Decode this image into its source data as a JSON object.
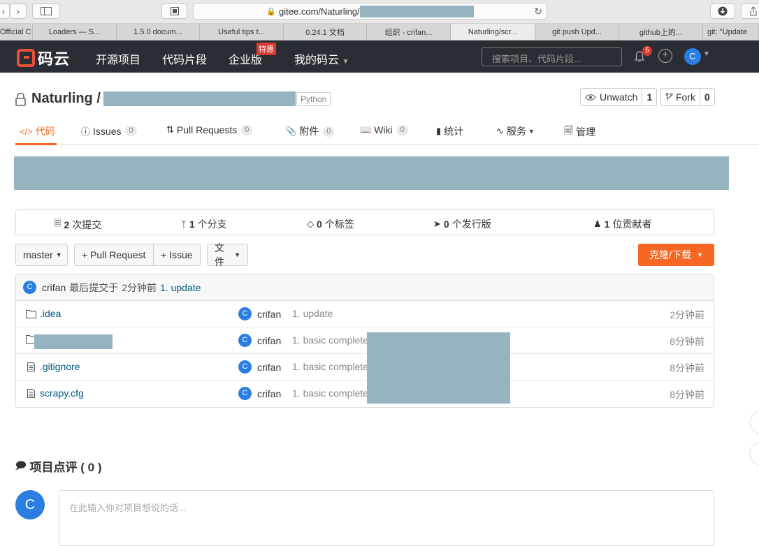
{
  "browser": {
    "url_prefix": "gitee.com/Naturling/",
    "tabs": [
      {
        "label": "Official C"
      },
      {
        "label": "Loaders — S..."
      },
      {
        "label": "1.5.0 docum..."
      },
      {
        "label": "Useful tips t..."
      },
      {
        "label": "0.24.1 文档"
      },
      {
        "label": "组织 - crifan..."
      },
      {
        "label": "Naturling/scr..."
      },
      {
        "label": "git push Upd..."
      },
      {
        "label": "github上的..."
      },
      {
        "label": "git: \"Update"
      }
    ]
  },
  "nav": {
    "logo": "码云",
    "links": [
      "开源项目",
      "代码片段",
      "企业版",
      "我的码云"
    ],
    "hot_badge": "特惠",
    "search_placeholder": "搜索项目、代码片段...",
    "notifications": "5",
    "user_initial": "C"
  },
  "repo": {
    "owner": "Naturling /",
    "language": "Python",
    "watch_label": "Unwatch",
    "watch_count": "1",
    "fork_label": "Fork",
    "fork_count": "0"
  },
  "tabs": [
    {
      "label": "代码",
      "count": null
    },
    {
      "label": "Issues",
      "count": "0"
    },
    {
      "label": "Pull Requests",
      "count": "0"
    },
    {
      "label": "附件",
      "count": "0"
    },
    {
      "label": "Wiki",
      "count": "0"
    },
    {
      "label": "统计",
      "count": null
    },
    {
      "label": "服务",
      "count": null
    },
    {
      "label": "管理",
      "count": null
    }
  ],
  "stats": [
    {
      "num": "2",
      "label": "次提交"
    },
    {
      "num": "1",
      "label": "个分支"
    },
    {
      "num": "0",
      "label": "个标签"
    },
    {
      "num": "0",
      "label": "个发行版"
    },
    {
      "num": "1",
      "label": "位贡献者"
    }
  ],
  "actions": {
    "branch": "master",
    "pull_request": "+ Pull Request",
    "issue": "+ Issue",
    "files": "文件",
    "clone": "克隆/下载"
  },
  "last_commit": {
    "author": "crifan",
    "text": "最后提交于",
    "when": "2分钟前",
    "message": "1. update"
  },
  "files": [
    {
      "name": ".idea",
      "type": "folder",
      "author": "crifan",
      "message": "1. update",
      "time": "2分钟前"
    },
    {
      "name": "",
      "type": "folder",
      "author": "crifan",
      "message": "1. basic complete",
      "time": "8分钟前"
    },
    {
      "name": ".gitignore",
      "type": "file",
      "author": "crifan",
      "message": "1. basic complete",
      "time": "8分钟前"
    },
    {
      "name": "scrapy.cfg",
      "type": "file",
      "author": "crifan",
      "message": "1. basic complete",
      "time": "8分钟前"
    }
  ],
  "comments": {
    "title": "项目点评 ( 0 )",
    "placeholder": "在此输入你对项目想说的话...",
    "user_initial": "C"
  },
  "colors": {
    "accent": "#f56722",
    "nav_bg": "#2b2d34",
    "link": "#005980",
    "redaction": "#96b3c0",
    "avatar": "#2a7de1"
  }
}
